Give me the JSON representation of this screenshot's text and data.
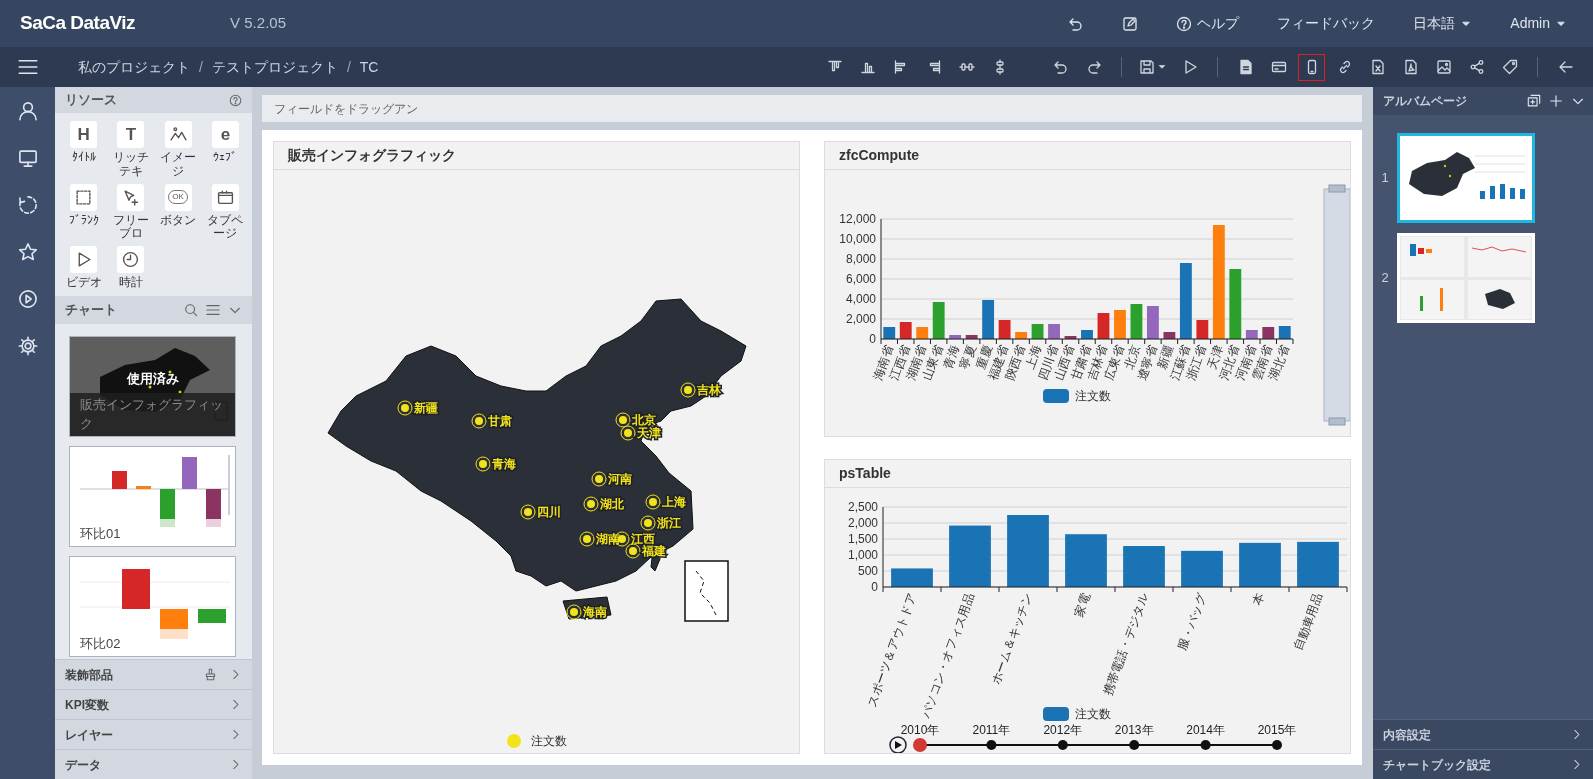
{
  "header": {
    "logo": "SaCa DataViz",
    "version": "V 5.2.05",
    "menu": [
      {
        "kind": "icon"
      },
      {
        "kind": "icon"
      },
      {
        "kind": "link",
        "label": "ヘルプ"
      },
      {
        "kind": "link",
        "label": "フィードバック"
      },
      {
        "kind": "dropdown",
        "label": "日本語"
      },
      {
        "kind": "dropdown",
        "label": "Admin"
      }
    ]
  },
  "breadcrumb": [
    {
      "kind": "item",
      "label": "私のプロジェクト"
    },
    {
      "kind": "separator",
      "label": "/"
    },
    {
      "kind": "item",
      "label": "テストプロジェクト"
    },
    {
      "kind": "separator",
      "label": "/"
    },
    {
      "kind": "item",
      "label": "TC"
    }
  ],
  "toolbar": [
    {
      "kind": "icon",
      "selected": false
    },
    {
      "kind": "icon",
      "selected": false
    },
    {
      "kind": "icon",
      "selected": false
    },
    {
      "kind": "icon",
      "selected": false
    },
    {
      "kind": "icon",
      "selected": false
    },
    {
      "kind": "icon",
      "selected": false
    },
    {
      "kind": "gap"
    },
    {
      "kind": "icon",
      "selected": false
    },
    {
      "kind": "icon",
      "selected": false
    },
    {
      "kind": "separator"
    },
    {
      "kind": "menu",
      "selected": false
    },
    {
      "kind": "icon",
      "selected": false
    },
    {
      "kind": "separator"
    },
    {
      "kind": "icon",
      "selected": false
    },
    {
      "kind": "icon",
      "selected": false
    },
    {
      "kind": "icon",
      "selected": true
    },
    {
      "kind": "icon",
      "selected": false
    },
    {
      "kind": "icon",
      "selected": false
    },
    {
      "kind": "icon",
      "selected": false
    },
    {
      "kind": "icon",
      "selected": false
    },
    {
      "kind": "icon",
      "selected": false
    },
    {
      "kind": "icon",
      "selected": false
    },
    {
      "kind": "separator"
    },
    {
      "kind": "icon",
      "selected": false
    }
  ],
  "resources": {
    "title": "リソース",
    "items": [
      {
        "kind": "glyph",
        "glyph": "H",
        "label": "ﾀｲﾄﾙ"
      },
      {
        "kind": "glyph",
        "glyph": "T",
        "label": "リッチテキ"
      },
      {
        "kind": "icon",
        "label": "イメージ"
      },
      {
        "kind": "glyph",
        "glyph": "e",
        "label": "ｳｪﾌﾞ"
      },
      {
        "kind": "icon",
        "label": "ﾌﾞﾗﾝｸ"
      },
      {
        "kind": "icon",
        "label": "フリーブロ"
      },
      {
        "kind": "pill",
        "glyph": "OK",
        "label": "ボタン"
      },
      {
        "kind": "icon",
        "label": "タブページ"
      },
      {
        "kind": "icon",
        "label": "ビデオ"
      },
      {
        "kind": "icon",
        "label": "時計"
      }
    ]
  },
  "chart_list": {
    "title": "チャート",
    "items": [
      {
        "kind": "map",
        "title": "販売インフォグラフィック",
        "badge": "使用済み"
      },
      {
        "kind": "bars",
        "title": "环比01"
      },
      {
        "kind": "waterfall",
        "title": "环比02"
      }
    ]
  },
  "sections": [
    {
      "label": "装飾部品"
    },
    {
      "label": "KPI変数"
    },
    {
      "label": "レイヤー"
    },
    {
      "label": "データ"
    }
  ],
  "canvas": {
    "drop_hint": "フィールドをドラッグアン",
    "widgets": [
      {
        "kind": "map",
        "title": "販売インフォグラフィック",
        "legend": "注文数",
        "points": [
          "新疆",
          "甘肃",
          "青海",
          "四川",
          "北京",
          "天津",
          "吉林",
          "河南",
          "湖北",
          "上海",
          "浙江",
          "湖南",
          "江西",
          "福建",
          "海南"
        ]
      },
      {
        "kind": "bar",
        "title": "zfcCompute",
        "slider": true,
        "chart_data": {
          "type": "bar",
          "categories": [
            "海南省",
            "江西省",
            "湖南省",
            "山東省",
            "青海",
            "寧夏",
            "重慶",
            "福建省",
            "陝西省",
            "上海",
            "四川省",
            "山西省",
            "甘粛省",
            "吉林省",
            "広東省",
            "北京",
            "遼寧省",
            "新疆",
            "江蘇省",
            "浙江省",
            "天津",
            "河北省",
            "河南省",
            "雲南省",
            "湖北省"
          ],
          "series": [
            {
              "name": "注文数",
              "color": "#1a73b5",
              "values": [
                1200,
                1700,
                1200,
                3700,
                400,
                400,
                3900,
                1900,
                700,
                1500,
                1500,
                300,
                900,
                2600,
                2900,
                3500,
                3300,
                700,
                7600,
                1900,
                11400,
                7000,
                900,
                1200,
                1300
              ],
              "colors": [
                "#1a73b5",
                "#d62728",
                "#ff7f0e",
                "#2ca02c",
                "#9467bd",
                "#8c3461",
                "#1a73b5",
                "#d62728",
                "#ff7f0e",
                "#2ca02c",
                "#9467bd",
                "#8c3461",
                "#1a73b5",
                "#d62728",
                "#ff7f0e",
                "#2ca02c",
                "#9467bd",
                "#8c3461",
                "#1a73b5",
                "#d62728",
                "#ff7f0e",
                "#2ca02c",
                "#9467bd",
                "#8c3461",
                "#1a73b5"
              ]
            }
          ],
          "ylim": [
            0,
            12000
          ],
          "grid": true,
          "yticks": [
            {
              "value": 0,
              "label": "0"
            },
            {
              "value": 2000,
              "label": "2,000"
            },
            {
              "value": 4000,
              "label": "4,000"
            },
            {
              "value": 6000,
              "label": "6,000"
            },
            {
              "value": 8000,
              "label": "8,000"
            },
            {
              "value": 10000,
              "label": "10,000"
            },
            {
              "value": 12000,
              "label": "12,000"
            }
          ]
        }
      },
      {
        "kind": "bar",
        "title": "psTable",
        "chart_data": {
          "type": "bar",
          "categories": [
            "スポーツ＆アウトドア",
            "パソコン・オフィス用品",
            "ホーム＆キッチン",
            "家電",
            "携帯電話・デジタル",
            "服・バッグ",
            "本",
            "自動車用品"
          ],
          "series": [
            {
              "name": "注文数",
              "color": "#1a73b5",
              "values": [
                580,
                1920,
                2250,
                1650,
                1280,
                1130,
                1380,
                1410
              ]
            }
          ],
          "ylim": [
            0,
            2500
          ],
          "grid": true,
          "yticks": [
            {
              "value": 0,
              "label": "0"
            },
            {
              "value": 500,
              "label": "500"
            },
            {
              "value": 1000,
              "label": "1,000"
            },
            {
              "value": 1500,
              "label": "1,500"
            },
            {
              "value": 2000,
              "label": "2,000"
            },
            {
              "value": 2500,
              "label": "2,500"
            }
          ]
        },
        "timeline": [
          {
            "label": "2010年",
            "selected": true
          },
          {
            "label": "2011年",
            "selected": false
          },
          {
            "label": "2012年",
            "selected": false
          },
          {
            "label": "2013年",
            "selected": false
          },
          {
            "label": "2014年",
            "selected": false
          },
          {
            "label": "2015年",
            "selected": false
          }
        ]
      }
    ]
  },
  "album": {
    "title": "アルバムページ",
    "pages": [
      {
        "number": "1",
        "kind": "map-bars",
        "selected": true
      },
      {
        "number": "2",
        "kind": "grid",
        "selected": false
      }
    ],
    "settings": [
      "内容設定",
      "チャートブック設定"
    ]
  }
}
